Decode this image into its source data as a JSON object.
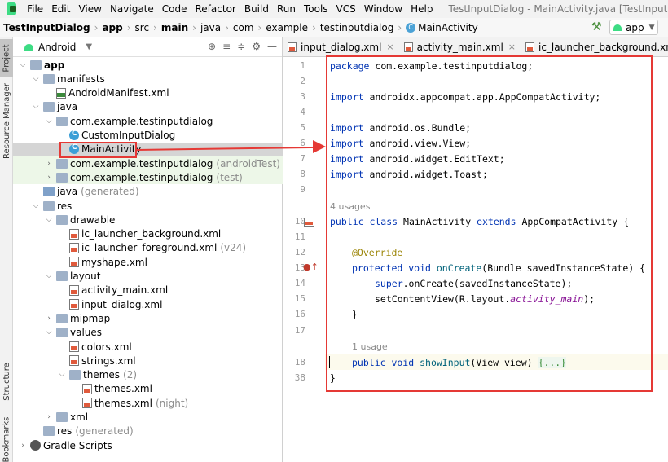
{
  "menubar": {
    "items": [
      "File",
      "Edit",
      "View",
      "Navigate",
      "Code",
      "Refactor",
      "Build",
      "Run",
      "Tools",
      "VCS",
      "Window",
      "Help"
    ],
    "window_title": "TestInputDialog - MainActivity.java [TestInputDialog.app.ma"
  },
  "breadcrumb": [
    "TestInputDialog",
    "app",
    "src",
    "main",
    "java",
    "com",
    "example",
    "testinputdialog",
    "MainActivity"
  ],
  "run_config": "app",
  "tool_strip": {
    "project": "Project",
    "resource_manager": "Resource Manager",
    "structure": "Structure",
    "bookmarks": "Bookmarks"
  },
  "project_panel": {
    "view_mode": "Android",
    "tree": [
      {
        "depth": 0,
        "arrow": "open",
        "icon": "folder",
        "label": "app",
        "bold": true
      },
      {
        "depth": 1,
        "arrow": "open",
        "icon": "folder",
        "label": "manifests"
      },
      {
        "depth": 2,
        "arrow": "",
        "icon": "mf",
        "label": "AndroidManifest.xml"
      },
      {
        "depth": 1,
        "arrow": "open",
        "icon": "folder",
        "label": "java"
      },
      {
        "depth": 2,
        "arrow": "open",
        "icon": "pkg",
        "label": "com.example.testinputdialog"
      },
      {
        "depth": 3,
        "arrow": "",
        "icon": "cls",
        "label": "CustomInputDialog"
      },
      {
        "depth": 3,
        "arrow": "",
        "icon": "cls",
        "label": "MainActivity",
        "selected": true
      },
      {
        "depth": 2,
        "arrow": "closed",
        "icon": "pkg",
        "label": "com.example.testinputdialog",
        "suffix": "(androidTest)",
        "modified": true
      },
      {
        "depth": 2,
        "arrow": "closed",
        "icon": "pkg",
        "label": "com.example.testinputdialog",
        "suffix": "(test)",
        "modified": true
      },
      {
        "depth": 1,
        "arrow": "",
        "icon": "java",
        "label": "java",
        "suffix": "(generated)"
      },
      {
        "depth": 1,
        "arrow": "open",
        "icon": "folder",
        "label": "res"
      },
      {
        "depth": 2,
        "arrow": "open",
        "icon": "folder",
        "label": "drawable"
      },
      {
        "depth": 3,
        "arrow": "",
        "icon": "xml",
        "label": "ic_launcher_background.xml"
      },
      {
        "depth": 3,
        "arrow": "",
        "icon": "xml",
        "label": "ic_launcher_foreground.xml",
        "suffix": "(v24)"
      },
      {
        "depth": 3,
        "arrow": "",
        "icon": "xml",
        "label": "myshape.xml"
      },
      {
        "depth": 2,
        "arrow": "open",
        "icon": "folder",
        "label": "layout"
      },
      {
        "depth": 3,
        "arrow": "",
        "icon": "xml",
        "label": "activity_main.xml"
      },
      {
        "depth": 3,
        "arrow": "",
        "icon": "xml",
        "label": "input_dialog.xml"
      },
      {
        "depth": 2,
        "arrow": "closed",
        "icon": "folder",
        "label": "mipmap"
      },
      {
        "depth": 2,
        "arrow": "open",
        "icon": "folder",
        "label": "values"
      },
      {
        "depth": 3,
        "arrow": "",
        "icon": "xml",
        "label": "colors.xml"
      },
      {
        "depth": 3,
        "arrow": "",
        "icon": "xml",
        "label": "strings.xml"
      },
      {
        "depth": 3,
        "arrow": "open",
        "icon": "folder",
        "label": "themes",
        "suffix": "(2)"
      },
      {
        "depth": 4,
        "arrow": "",
        "icon": "xml",
        "label": "themes.xml"
      },
      {
        "depth": 4,
        "arrow": "",
        "icon": "xml",
        "label": "themes.xml",
        "suffix": "(night)"
      },
      {
        "depth": 2,
        "arrow": "closed",
        "icon": "folder",
        "label": "xml"
      },
      {
        "depth": 1,
        "arrow": "",
        "icon": "folder",
        "label": "res",
        "suffix": "(generated)"
      },
      {
        "depth": 0,
        "arrow": "closed",
        "icon": "gear",
        "label": "Gradle Scripts"
      }
    ]
  },
  "editor_tabs": [
    {
      "label": "input_dialog.xml",
      "close": "×"
    },
    {
      "label": "activity_main.xml",
      "close": "×"
    },
    {
      "label": "ic_launcher_background.xml",
      "close": "×"
    }
  ],
  "line_numbers": [
    "1",
    "2",
    "3",
    "4",
    "5",
    "6",
    "7",
    "8",
    "9",
    "",
    "10",
    "11",
    "12",
    "13",
    "14",
    "15",
    "16",
    "17",
    "",
    "18",
    "38"
  ],
  "code": {
    "l1": "package com.example.testinputdialog;",
    "l3": "import androidx.appcompat.app.AppCompatActivity;",
    "l5": "import android.os.Bundle;",
    "l6": "import android.view.View;",
    "l7": "import android.widget.EditText;",
    "l8": "import android.widget.Toast;",
    "usages1": "4 usages",
    "l10": "public class MainActivity extends AppCompatActivity {",
    "l12": "@Override",
    "l13": "protected void onCreate(Bundle savedInstanceState) {",
    "l14": "super.onCreate(savedInstanceState);",
    "l15": "setContentView(R.layout.activity_main);",
    "l16": "}",
    "usages2": "1 usage",
    "l18": "public void showInput(View view) {...}",
    "l38": "}"
  },
  "annotation_color": "#e53935"
}
